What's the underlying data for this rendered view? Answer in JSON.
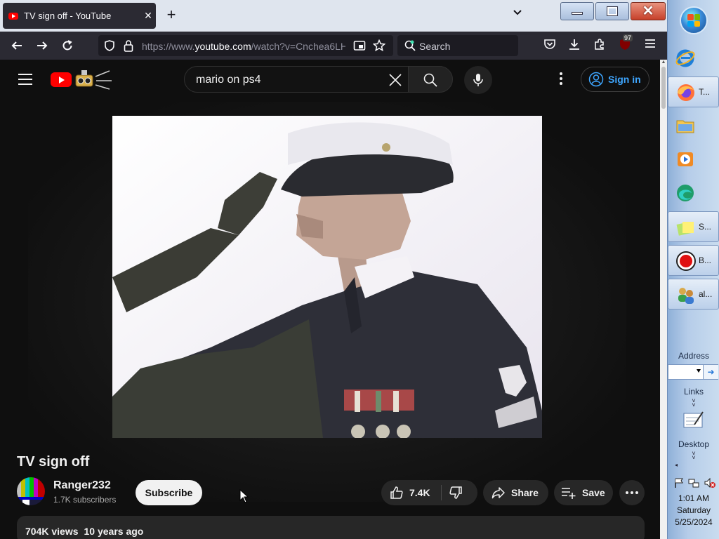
{
  "browser": {
    "tab": {
      "title": "TV sign off - YouTube"
    },
    "url": {
      "prefix": "https://www.",
      "domain": "youtube.com",
      "path": "/watch?v=Cnchea6LH"
    },
    "search_placeholder": "Search",
    "extension_badge": "97"
  },
  "youtube": {
    "search_query": "mario on ps4",
    "signin_label": "Sign in",
    "video": {
      "title": "TV sign off",
      "channel": "Ranger232",
      "subscribers": "1.7K subscribers",
      "subscribe_label": "Subscribe",
      "likes": "7.4K",
      "share_label": "Share",
      "save_label": "Save",
      "views": "704K views",
      "age": "10 years ago"
    }
  },
  "taskbar": {
    "items": [
      {
        "label": "",
        "icon": "internet-explorer-icon"
      },
      {
        "label": "T...",
        "icon": "firefox-icon"
      },
      {
        "label": "",
        "icon": "file-explorer-icon"
      },
      {
        "label": "",
        "icon": "media-player-icon"
      },
      {
        "label": "",
        "icon": "edge-icon"
      },
      {
        "label": "S...",
        "icon": "sticky-notes-icon"
      },
      {
        "label": "B...",
        "icon": "record-icon"
      },
      {
        "label": "al...",
        "icon": "users-icon"
      }
    ],
    "address_label": "Address",
    "links_label": "Links",
    "desktop_label": "Desktop",
    "clock": {
      "time": "1:01 AM",
      "day": "Saturday",
      "date": "5/25/2024"
    }
  },
  "colors": {
    "yt_red": "#ff0000",
    "link_blue": "#3ea6ff",
    "bg": "#0f0f0f",
    "pill": "#272727"
  }
}
